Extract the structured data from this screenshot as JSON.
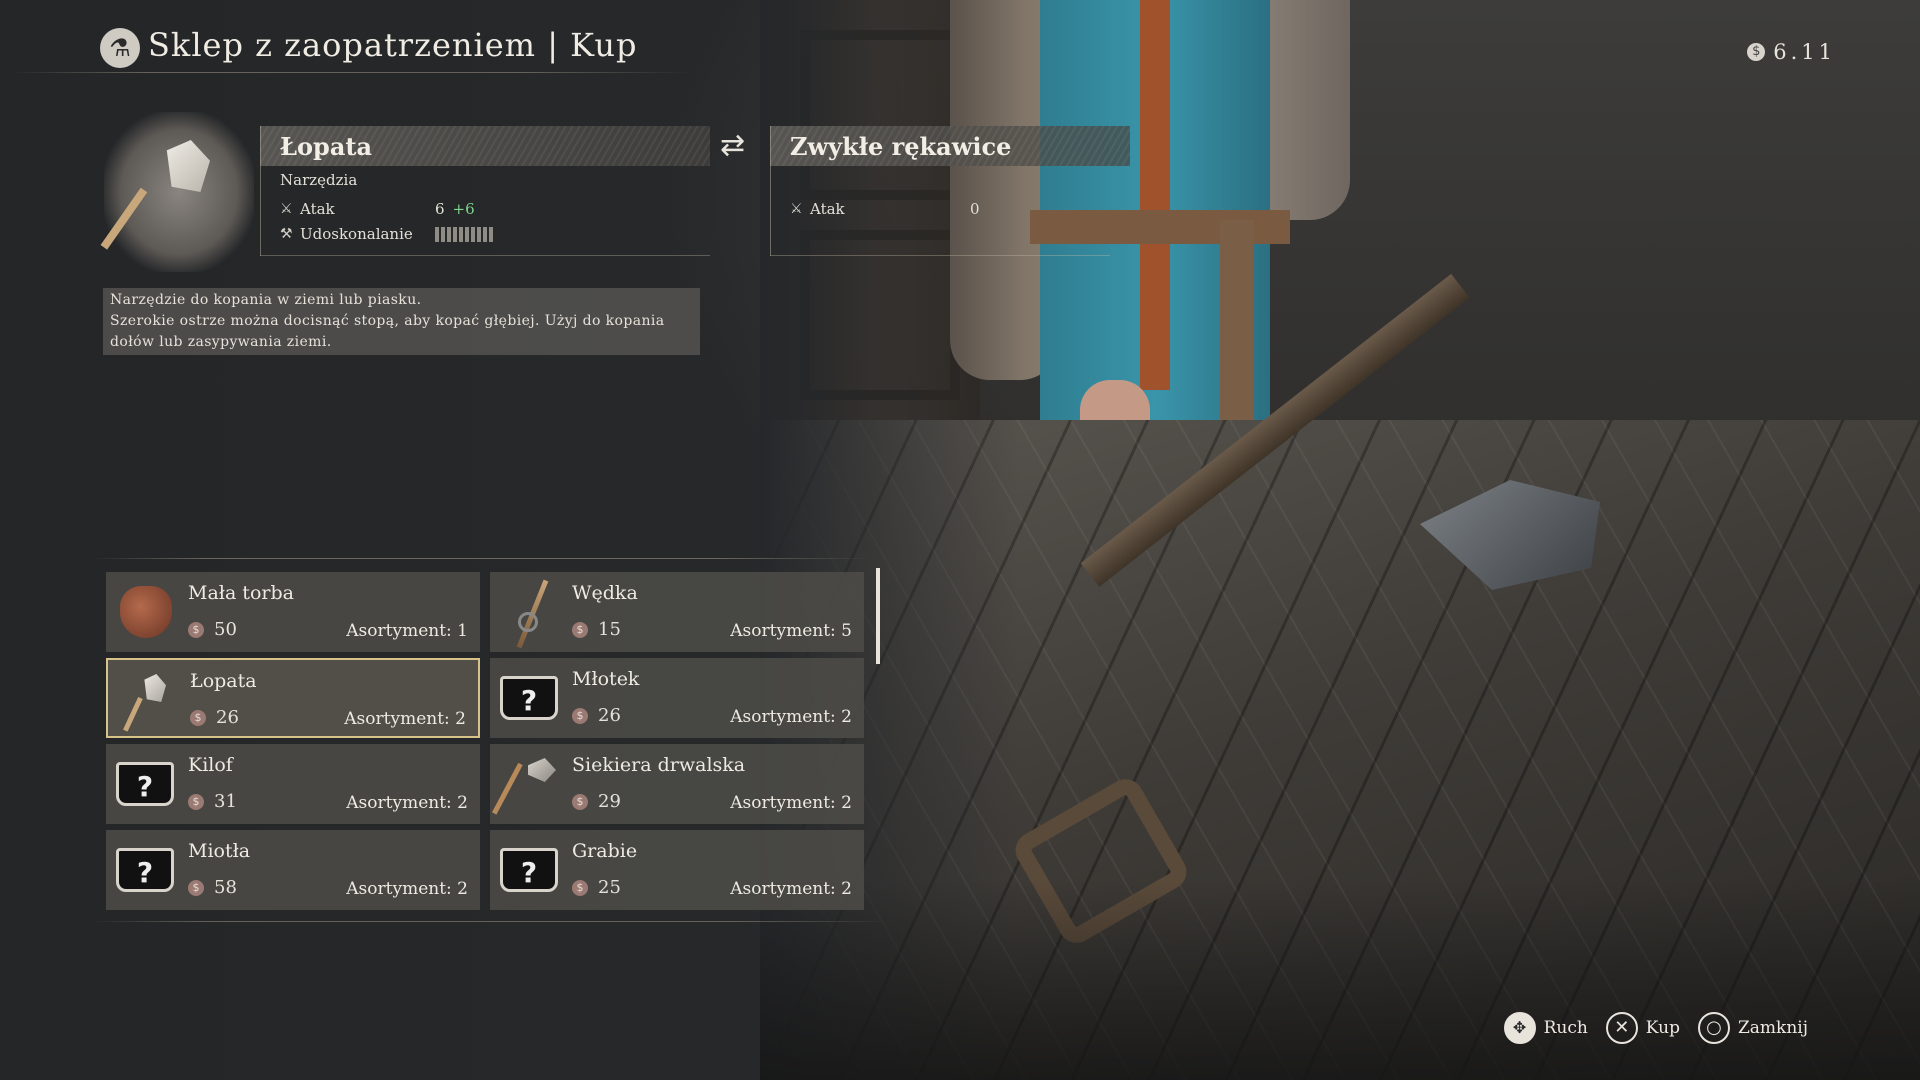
{
  "header": {
    "shop_icon": "potion-flask-icon",
    "title": "Sklep z zaopatrzeniem | Kup",
    "money": "6.11",
    "coin_icon": "coin-icon"
  },
  "detail": {
    "item_image": "shovel-image",
    "selected": {
      "name": "Łopata",
      "category": "Narzędzia",
      "stats": [
        {
          "icon": "sword-icon",
          "label": "Atak",
          "value": "6",
          "bonus": "+6"
        },
        {
          "icon": "anvil-icon",
          "label": "Udoskonalanie",
          "upgrade_slots": 10
        }
      ]
    },
    "swap_icon": "swap-arrows-icon",
    "compare": {
      "name": "Zwykłe rękawice",
      "stats": [
        {
          "icon": "sword-icon",
          "label": "Atak",
          "value": "0"
        }
      ]
    },
    "description": "Narzędzie do kopania w ziemi lub piasku.\nSzerokie ostrze można docisnąć stopą, aby kopać głębiej. Użyj do kopania dołów lub zasypywania ziemi."
  },
  "items": [
    {
      "name": "Mała torba",
      "price": "50",
      "stock": "Asortyment: 1",
      "icon": "bag-icon"
    },
    {
      "name": "Wędka",
      "price": "15",
      "stock": "Asortyment: 5",
      "icon": "fishing-rod-icon"
    },
    {
      "name": "Łopata",
      "price": "26",
      "stock": "Asortyment: 2",
      "icon": "shovel-icon",
      "selected": true
    },
    {
      "name": "Młotek",
      "price": "26",
      "stock": "Asortyment: 2",
      "icon": "unknown-item-icon"
    },
    {
      "name": "Kilof",
      "price": "31",
      "stock": "Asortyment: 2",
      "icon": "unknown-item-icon"
    },
    {
      "name": "Siekiera drwalska",
      "price": "29",
      "stock": "Asortyment: 2",
      "icon": "axe-icon"
    },
    {
      "name": "Miotła",
      "price": "58",
      "stock": "Asortyment: 2",
      "icon": "unknown-item-icon"
    },
    {
      "name": "Grabie",
      "price": "25",
      "stock": "Asortyment: 2",
      "icon": "unknown-item-icon"
    }
  ],
  "hints": [
    {
      "label": "Ruch",
      "icon": "dpad-icon"
    },
    {
      "label": "Kup",
      "icon": "cross-button-icon"
    },
    {
      "label": "Zamknij",
      "icon": "circle-button-icon"
    }
  ],
  "colors": {
    "selection_border": "#d7c28a",
    "bonus_green": "#7fd38a"
  }
}
